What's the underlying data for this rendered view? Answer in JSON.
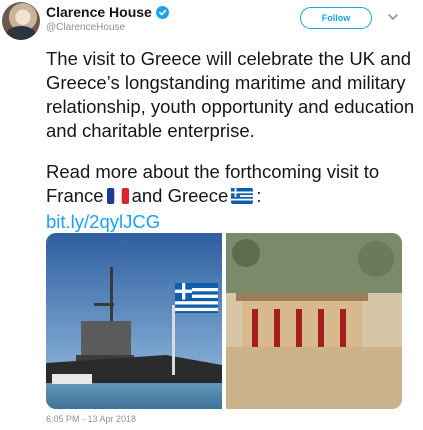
{
  "account": {
    "name": "Clarence House",
    "handle": "@ClarenceHouse",
    "verified": true
  },
  "actions": {
    "follow_label": "Follow"
  },
  "tweet": {
    "paragraph1": "The visit to Greece will celebrate the UK and Greece’s longstanding maritime and military relationship, youth opportunity and education and charitable enterprise.",
    "paragraph2_prefix": "Read more about the forthcoming visit to France",
    "paragraph2_middle": "and Greece",
    "paragraph2_suffix": ":",
    "link": "bit.ly/2qylJCG",
    "timestamp": "6:05 PM - 13 Apr 2018"
  },
  "icons": {
    "verified": "verified-badge-icon",
    "caret": "chevron-down-icon",
    "flag_fr": "france-flag-icon",
    "flag_gr": "greece-flag-icon"
  },
  "colors": {
    "link": "#1da1f2",
    "text": "#14171a",
    "muted": "#8a949c"
  },
  "media": {
    "images": [
      "warship-with-greek-flag-photo",
      "knossos-palace-ruins-photo"
    ]
  }
}
